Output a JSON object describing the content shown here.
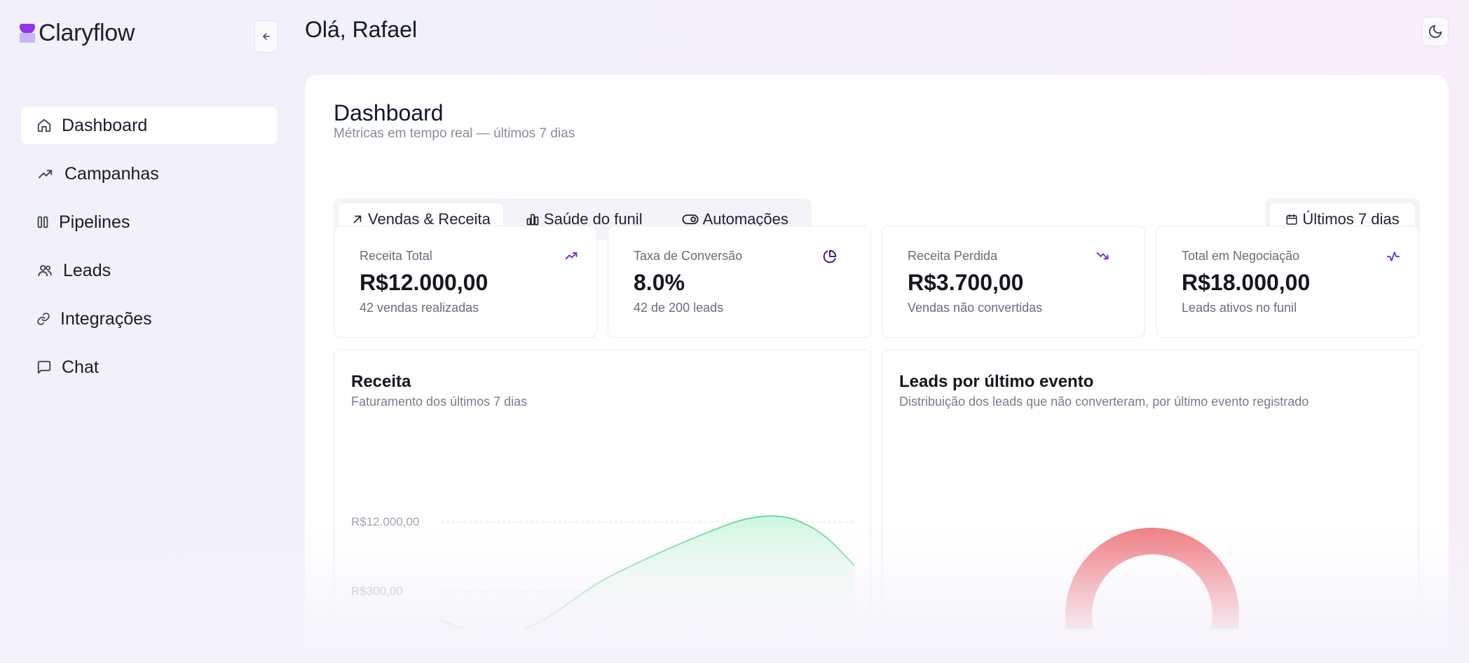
{
  "brand": {
    "name": "Claryflow"
  },
  "sidebar": {
    "items": [
      {
        "label": "Dashboard",
        "icon": "home-icon"
      },
      {
        "label": "Campanhas",
        "icon": "trending-up-icon"
      },
      {
        "label": "Pipelines",
        "icon": "columns-icon"
      },
      {
        "label": "Leads",
        "icon": "users-icon"
      },
      {
        "label": "Integrações",
        "icon": "link-icon"
      },
      {
        "label": "Chat",
        "icon": "message-square-icon"
      }
    ],
    "active": "Dashboard"
  },
  "header": {
    "greeting": "Olá, Rafael"
  },
  "page": {
    "title": "Dashboard",
    "subtitle": "Métricas em tempo real — últimos 7 dias"
  },
  "tabs": [
    {
      "label": "Vendas & Receita",
      "icon": "arrow-up-right-icon"
    },
    {
      "label": "Saúde do funil",
      "icon": "bar-chart-icon"
    },
    {
      "label": "Automações",
      "icon": "toggle-icon"
    }
  ],
  "active_tab": "Vendas & Receita",
  "range": {
    "label": "Últimos 7 dias"
  },
  "kpis": [
    {
      "label": "Receita Total",
      "value": "R$12.000,00",
      "sub": "42 vendas realizadas",
      "icon": "trending-up-icon"
    },
    {
      "label": "Taxa de Conversão",
      "value": "8.0%",
      "sub": "42 de 200 leads",
      "icon": "pie-chart-icon"
    },
    {
      "label": "Receita Perdida",
      "value": "R$3.700,00",
      "sub": "Vendas não convertidas",
      "icon": "trending-down-icon"
    },
    {
      "label": "Total em Negociação",
      "value": "R$18.000,00",
      "sub": "Leads ativos no funil",
      "icon": "activity-icon"
    }
  ],
  "revenue_card": {
    "title": "Receita",
    "subtitle": "Faturamento dos últimos 7 dias",
    "ticks": [
      "R$12.000,00",
      "R$300,00"
    ]
  },
  "leads_card": {
    "title": "Leads por último evento",
    "subtitle": "Distribuição dos leads que não converteram, por último evento registrado"
  },
  "colors": {
    "accent": "#6d28d9",
    "brand_top": "#9333ea",
    "brand_bottom": "#c4b5fd",
    "line": "#6fd8a0",
    "donut": "#ef7b7f"
  }
}
